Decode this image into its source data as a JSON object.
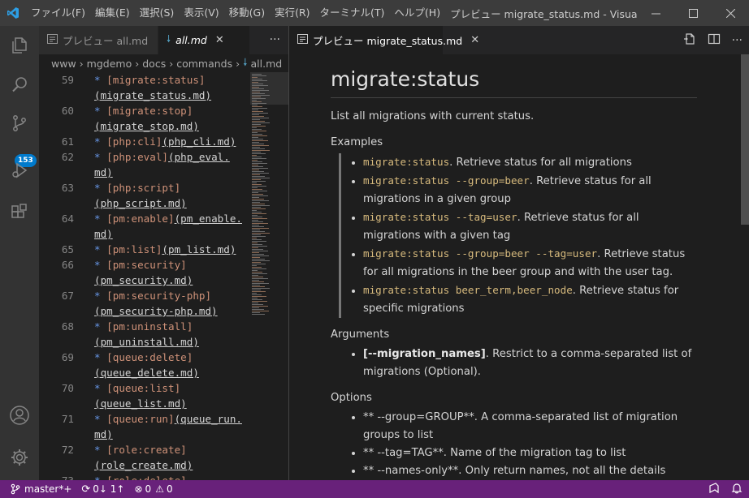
{
  "titlebar": {
    "menu": [
      "ファイル(F)",
      "編集(E)",
      "選択(S)",
      "表示(V)",
      "移動(G)",
      "実行(R)",
      "ターミナル(T)",
      "ヘルプ(H)"
    ],
    "title": "プレビュー migrate_status.md - Visual Studio ...",
    "icons": [
      "vscode-logo-icon",
      "minimize-icon",
      "maximize-icon",
      "close-icon"
    ]
  },
  "activitybar": {
    "items": [
      "explorer-icon",
      "search-icon",
      "source-control-icon",
      "run-debug-icon",
      "extensions-icon",
      "accounts-icon",
      "settings-gear-icon"
    ],
    "scm_badge": "153"
  },
  "left_editor": {
    "tabs": [
      {
        "label": "プレビュー all.md",
        "icon": "preview-icon",
        "active": false
      },
      {
        "label": "all.md",
        "icon": "markdown-icon",
        "active": true
      }
    ],
    "more": "···",
    "breadcrumb": [
      "www",
      "mgdemo",
      "docs",
      "commands",
      "all.md"
    ],
    "lines": [
      {
        "n": "59",
        "a": "* ",
        "t": "[migrate:status]",
        "u": ""
      },
      {
        "n": "",
        "a": "",
        "t": "",
        "u": "(migrate_status.md)"
      },
      {
        "n": "60",
        "a": "* ",
        "t": "[migrate:stop]",
        "u": ""
      },
      {
        "n": "",
        "a": "",
        "t": "",
        "u": "(migrate_stop.md)"
      },
      {
        "n": "61",
        "a": "* ",
        "t": "[php:cli]",
        "u": "(php_cli.md)"
      },
      {
        "n": "62",
        "a": "* ",
        "t": "[php:eval]",
        "u": "(php_eval."
      },
      {
        "n": "",
        "a": "",
        "t": "",
        "u": "md)"
      },
      {
        "n": "63",
        "a": "* ",
        "t": "[php:script]",
        "u": ""
      },
      {
        "n": "",
        "a": "",
        "t": "",
        "u": "(php_script.md)"
      },
      {
        "n": "64",
        "a": "* ",
        "t": "[pm:enable]",
        "u": "(pm_enable."
      },
      {
        "n": "",
        "a": "",
        "t": "",
        "u": "md)"
      },
      {
        "n": "65",
        "a": "* ",
        "t": "[pm:list]",
        "u": "(pm_list.md)"
      },
      {
        "n": "66",
        "a": "* ",
        "t": "[pm:security]",
        "u": ""
      },
      {
        "n": "",
        "a": "",
        "t": "",
        "u": "(pm_security.md)"
      },
      {
        "n": "67",
        "a": "* ",
        "t": "[pm:security-php]",
        "u": ""
      },
      {
        "n": "",
        "a": "",
        "t": "",
        "u": "(pm_security-php.md)"
      },
      {
        "n": "68",
        "a": "* ",
        "t": "[pm:uninstall]",
        "u": ""
      },
      {
        "n": "",
        "a": "",
        "t": "",
        "u": "(pm_uninstall.md)"
      },
      {
        "n": "69",
        "a": "* ",
        "t": "[queue:delete]",
        "u": ""
      },
      {
        "n": "",
        "a": "",
        "t": "",
        "u": "(queue_delete.md)"
      },
      {
        "n": "70",
        "a": "* ",
        "t": "[queue:list]",
        "u": ""
      },
      {
        "n": "",
        "a": "",
        "t": "",
        "u": "(queue_list.md)"
      },
      {
        "n": "71",
        "a": "* ",
        "t": "[queue:run]",
        "u": "(queue_run."
      },
      {
        "n": "",
        "a": "",
        "t": "",
        "u": "md)"
      },
      {
        "n": "72",
        "a": "* ",
        "t": "[role:create]",
        "u": ""
      },
      {
        "n": "",
        "a": "",
        "t": "",
        "u": "(role_create.md)"
      },
      {
        "n": "73",
        "a": "* ",
        "t": "[role:delete]",
        "u": ""
      }
    ]
  },
  "right_editor": {
    "tab": {
      "label": "プレビュー migrate_status.md",
      "icon": "preview-icon"
    },
    "actions": [
      "open-source-icon",
      "split-editor-icon",
      "more-actions-icon"
    ],
    "preview": {
      "title": "migrate:status",
      "intro": "List all migrations with current status.",
      "examples_heading": "Examples",
      "examples": [
        {
          "code": "migrate:status",
          "text": ". Retrieve status for all migrations"
        },
        {
          "code": "migrate:status --group=beer",
          "text": ". Retrieve status for all migrations in a given group"
        },
        {
          "code": "migrate:status --tag=user",
          "text": ". Retrieve status for all migrations with a given tag"
        },
        {
          "code": "migrate:status --group=beer --tag=user",
          "text": ". Retrieve status for all migrations in the beer group and with the user tag."
        },
        {
          "code": "migrate:status beer_term,beer_node",
          "text": ". Retrieve status for specific migrations"
        }
      ],
      "arguments_heading": "Arguments",
      "arguments": [
        {
          "bold": "[--migration_names]",
          "text": ". Restrict to a comma-separated list of migrations (Optional)."
        }
      ],
      "options_heading": "Options",
      "options": [
        "** --group=GROUP**. A comma-separated list of migration groups to list",
        "** --tag=TAG**. Name of the migration tag to list",
        "** --names-only**. Only return names, not all the details (faster)"
      ]
    }
  },
  "statusbar": {
    "branch": "master*+",
    "sync": "0↓ 1↑",
    "errors": "0",
    "warnings": "0",
    "right_icons": [
      "feedback-icon",
      "notifications-bell-icon"
    ]
  },
  "colors": {
    "statusbar_bg": "#68217a",
    "titlebar_bg": "#3c3c3c",
    "activitybar_bg": "#333333",
    "editor_bg": "#1e1e1e",
    "badge_bg": "#007acc",
    "inline_code": "#d7ba7d"
  }
}
